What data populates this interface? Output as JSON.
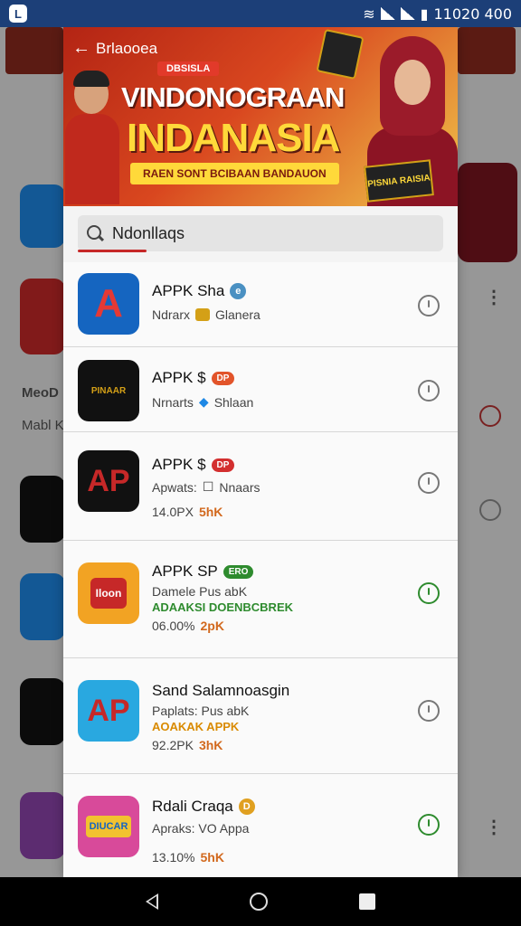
{
  "status_bar": {
    "time": "11020 400"
  },
  "banner": {
    "back_label": "Brlaooea",
    "tag": "DBSISLA",
    "headline_1": "VINDONOGRAAN",
    "headline_2": "INDANASIA",
    "ribbon": "RAEN SONT BCIBAAN BANDAUON",
    "prize_label": "PISNIA RAISIA"
  },
  "search": {
    "value": "Ndonllaqs"
  },
  "background": {
    "text_1": "MeoD",
    "text_2": "Mabl K"
  },
  "apps": [
    {
      "title": "APPK Sha",
      "badge": "e",
      "line1": "Ndrarx",
      "line1_b": "Glanera",
      "line2": "",
      "line3": "",
      "status": "gray",
      "icon_color": "#1565c0",
      "icon_letter": "A",
      "badge_color": "#4a90c2"
    },
    {
      "title": "APPK $",
      "badge": "DP",
      "line1": "Nrnarts",
      "line1_b": "Shlaan",
      "line2": "",
      "line3": "",
      "status": "gray",
      "icon_color": "#111111",
      "icon_letter": "PINAAR",
      "badge_color": "#e2542a"
    },
    {
      "title": "APPK $",
      "badge": "DP",
      "line1": "Apwats:",
      "line1_b": "Nnaars",
      "line2": "",
      "line3": "14.0PX",
      "line3_b": "5hK",
      "status": "gray",
      "icon_color": "#111111",
      "icon_letter": "AP",
      "badge_color": "#d32f2f"
    },
    {
      "title": "APPK SP",
      "badge": "ERO",
      "line1": "Damele Pus abK",
      "line1_b": "",
      "line2": "ADAAKSI DOENBCBREK",
      "line3": "06.00%",
      "line3_b": "2pK",
      "status": "green",
      "icon_color": "#f2a323",
      "icon_letter": "Iloon",
      "badge_color": "#2e8b2e"
    },
    {
      "title": "Sand Salamnoasgin",
      "badge": "",
      "line1": "Paplats: Pus abK",
      "line1_b": "",
      "line2": "AOAKAK APPK",
      "line3": "92.2PK",
      "line3_b": "3hK",
      "status": "gray",
      "icon_color": "#29a8e0",
      "icon_letter": "AP",
      "badge_color": ""
    },
    {
      "title": "Rdali Craqa",
      "badge": "D",
      "line1": "Apraks: VO Appa",
      "line1_b": "",
      "line2": "",
      "line3": "13.10%",
      "line3_b": "5hK",
      "status": "green",
      "icon_color": "#d84a9a",
      "icon_letter": "DIUCAR",
      "badge_color": "#e0a020"
    }
  ],
  "colors": {
    "accent_red": "#c62828",
    "status_bar": "#1c3f78",
    "success_green": "#2e8b2e"
  }
}
